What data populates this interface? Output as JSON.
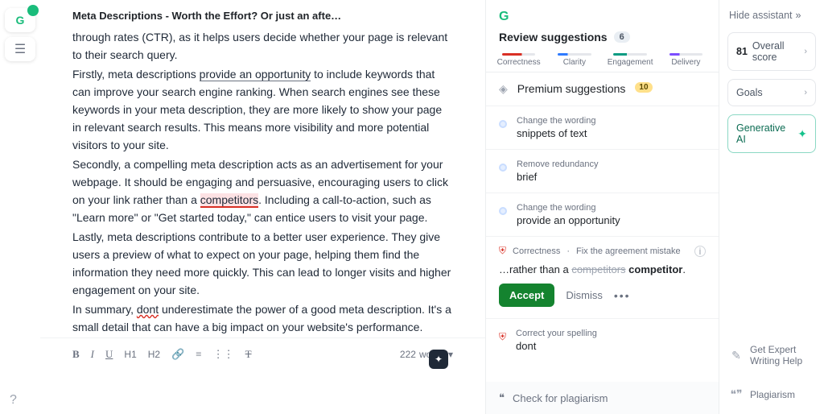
{
  "dock": {
    "main_label": "G",
    "tools_glyph": "☰"
  },
  "doc": {
    "title": "Meta Descriptions - Worth the Effort? Or just an afte…",
    "p1a": "through rates (CTR), as it helps users decide whether your page is relevant to their search query.",
    "p2a": "Firstly, meta descriptions ",
    "p2u": "provide an opportunity",
    "p2b": " to include keywords that can improve your search engine ranking. When search engines see these keywords in your meta description, they are more likely to show your page in relevant search results. This means more visibility and more potential visitors to your site.",
    "p3a": "Secondly, a compelling meta description acts as an advertisement for your webpage. It should be engaging and persuasive, encouraging users to click on your link rather than a ",
    "p3err": "competitors",
    "p3b": ". Including a call-to-action, such as \"Learn more\" or \"Get started today,\" can entice users to visit your page.",
    "p4": "Lastly, meta descriptions contribute to a better user experience. They give users a preview of what to expect on your page, helping them find the information they need more quickly. This can lead to longer visits and higher engagement on your site.",
    "p5a": "In summary, ",
    "p5err": "dont",
    "p5b": " underestimate the power of a good meta description. It's a small detail that can have a big impact on your website's performance."
  },
  "toolbar": {
    "b": "B",
    "i": "I",
    "u": "U",
    "h1": "H1",
    "h2": "H2",
    "word_count": "222",
    "word_label": "words"
  },
  "panel": {
    "logo": "G",
    "title": "Review suggestions",
    "count": "6",
    "tabs": {
      "t1": "Correctness",
      "t2": "Clarity",
      "t3": "Engagement",
      "t4": "Delivery"
    },
    "premium_label": "Premium suggestions",
    "premium_count": "10",
    "s1": {
      "hint": "Change the wording",
      "text": "snippets of text"
    },
    "s2": {
      "hint": "Remove redundancy",
      "text": "brief"
    },
    "s3": {
      "hint": "Change the wording",
      "text": "provide an opportunity"
    },
    "exp": {
      "category": "Correctness",
      "rule": "Fix the agreement mistake",
      "prefix": "…rather than a ",
      "wrong": "competitors",
      "right": "competitor",
      "accept": "Accept",
      "dismiss": "Dismiss"
    },
    "s4": {
      "hint": "Correct your spelling",
      "text": "dont"
    },
    "plagiarism": "Check for plagiarism"
  },
  "rail": {
    "hide": "Hide assistant",
    "score_num": "81",
    "score_label": "Overall score",
    "goals": "Goals",
    "gen": "Generative AI",
    "help1": "Get Expert",
    "help2": "Writing Help",
    "plag": "Plagiarism"
  }
}
